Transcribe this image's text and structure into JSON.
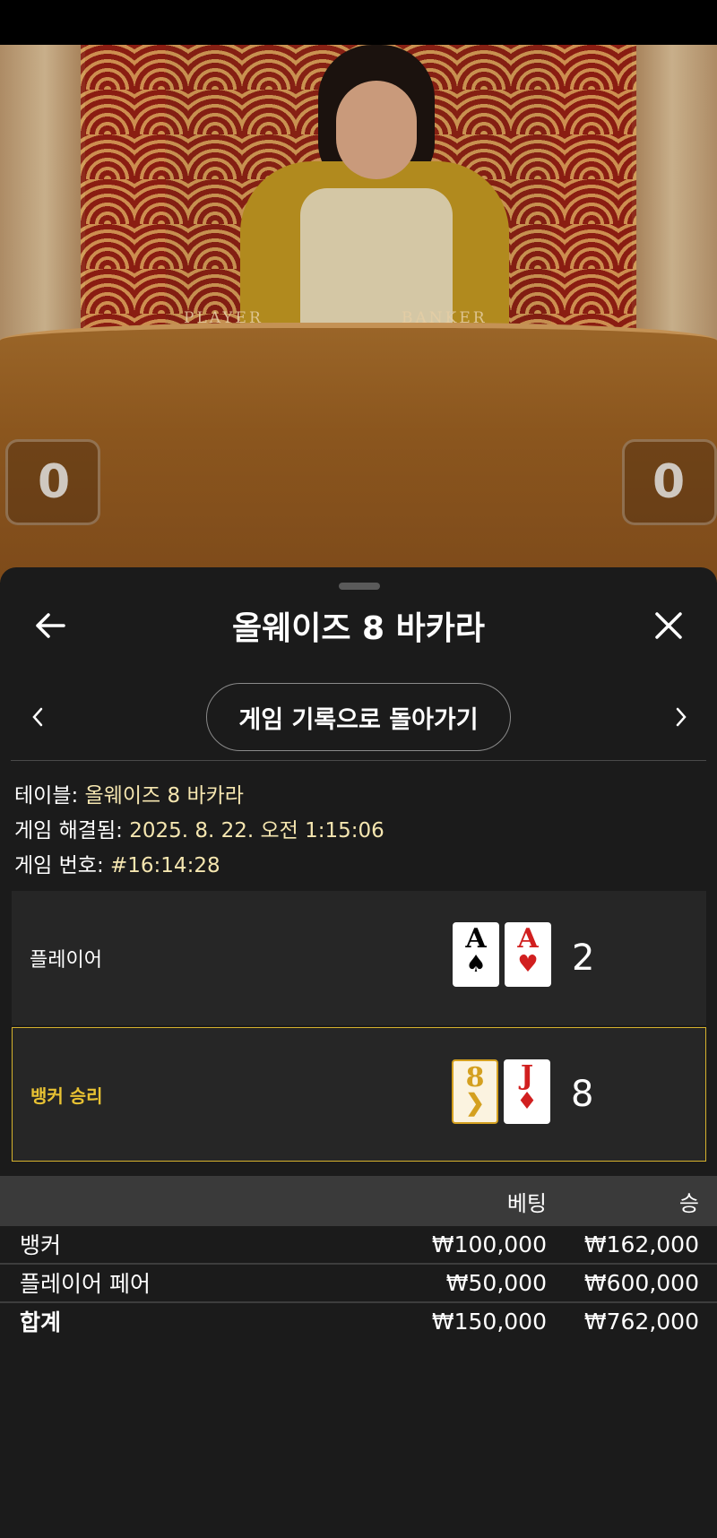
{
  "video": {
    "player_label": "PLAYER",
    "banker_label": "BANKER",
    "player_score": "0",
    "banker_score": "0"
  },
  "header": {
    "title": "올웨이즈 8 바카라",
    "back_icon": "arrow-left-icon",
    "close_icon": "close-icon"
  },
  "nav": {
    "back_to_history": "게임 기록으로 돌아가기",
    "prev_icon": "chevron-left-icon",
    "next_icon": "chevron-right-icon"
  },
  "info": {
    "table_label": "테이블:",
    "table_value": "올웨이즈 8 바카라",
    "resolved_label": "게임 해결됨:",
    "resolved_value": "2025. 8. 22. 오전 1:15:06",
    "number_label": "게임 번호:",
    "number_value": "#16:14:28"
  },
  "hands": [
    {
      "label": "플레이어",
      "score": "2",
      "cards": [
        {
          "rank": "A",
          "suit": "♠",
          "color": "black"
        },
        {
          "rank": "A",
          "suit": "♥",
          "color": "red"
        }
      ]
    },
    {
      "label": "뱅커 승리",
      "score": "8",
      "winner": true,
      "cards": [
        {
          "rank": "8",
          "suit": "❯",
          "color": "gold"
        },
        {
          "rank": "J",
          "suit": "♦",
          "color": "red"
        }
      ]
    }
  ],
  "bets": {
    "headers": {
      "bet": "베팅",
      "win": "승"
    },
    "rows": [
      {
        "name": "뱅커",
        "bet": "₩100,000",
        "win": "₩162,000"
      },
      {
        "name": "플레이어 페어",
        "bet": "₩50,000",
        "win": "₩600,000"
      },
      {
        "name": "합계",
        "bet": "₩150,000",
        "win": "₩762,000"
      }
    ]
  },
  "colors": {
    "winner_accent": "#e8c233",
    "info_value": "#f5e6b0",
    "sheet_bg": "#1b1b1b"
  }
}
